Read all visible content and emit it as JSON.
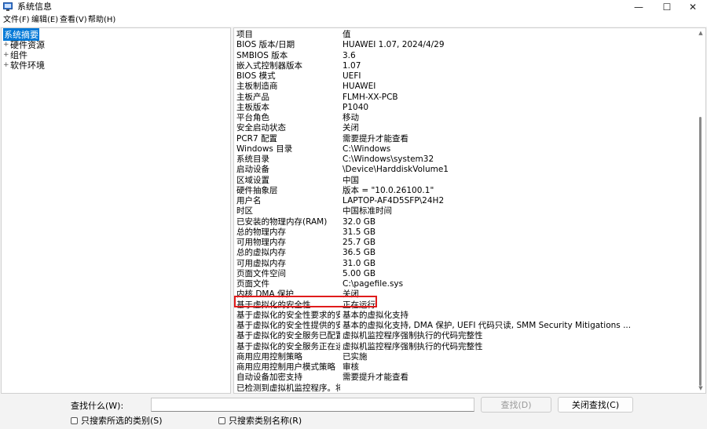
{
  "window": {
    "title": "系统信息",
    "controls": {
      "minimize": "—",
      "maximize": "☐",
      "close": "✕"
    }
  },
  "menu": [
    "文件(F)",
    "编辑(E)",
    "查看(V)",
    "帮助(H)"
  ],
  "tree": [
    {
      "label": "系统摘要",
      "expander": "",
      "selected": true
    },
    {
      "label": "硬件资源",
      "expander": "+",
      "selected": false
    },
    {
      "label": "组件",
      "expander": "+",
      "selected": false
    },
    {
      "label": "软件环境",
      "expander": "+",
      "selected": false
    }
  ],
  "table": {
    "rows": [
      [
        "项目",
        "值"
      ],
      [
        "BIOS 版本/日期",
        "HUAWEI 1.07, 2024/4/29"
      ],
      [
        "SMBIOS 版本",
        "3.6"
      ],
      [
        "嵌入式控制器版本",
        "1.07"
      ],
      [
        "BIOS 模式",
        "UEFI"
      ],
      [
        "主板制造商",
        "HUAWEI"
      ],
      [
        "主板产品",
        "FLMH-XX-PCB"
      ],
      [
        "主板版本",
        "P1040"
      ],
      [
        "平台角色",
        "移动"
      ],
      [
        "安全启动状态",
        "关闭"
      ],
      [
        "PCR7 配置",
        "需要提升才能查看"
      ],
      [
        "Windows 目录",
        "C:\\Windows"
      ],
      [
        "系统目录",
        "C:\\Windows\\system32"
      ],
      [
        "启动设备",
        "\\Device\\HarddiskVolume1"
      ],
      [
        "区域设置",
        "中国"
      ],
      [
        "硬件抽象层",
        "版本 = \"10.0.26100.1\""
      ],
      [
        "用户名",
        "LAPTOP-AF4D5SFP\\24H2"
      ],
      [
        "时区",
        "中国标准时间"
      ],
      [
        "已安装的物理内存(RAM)",
        "32.0 GB"
      ],
      [
        "总的物理内存",
        "31.5 GB"
      ],
      [
        "可用物理内存",
        "25.7 GB"
      ],
      [
        "总的虚拟内存",
        "36.5 GB"
      ],
      [
        "可用虚拟内存",
        "31.0 GB"
      ],
      [
        "页面文件空间",
        "5.00 GB"
      ],
      [
        "页面文件",
        "C:\\pagefile.sys"
      ],
      [
        "内核 DMA 保护",
        "关闭"
      ],
      [
        "基于虚拟化的安全性",
        "正在运行"
      ],
      [
        "基于虚拟化的安全性要求的安...",
        "基本的虚拟化支持"
      ],
      [
        "基于虚拟化的安全性提供的安...",
        "基本的虚拟化支持, DMA 保护, UEFI 代码只读, SMM Security Mitigations ..."
      ],
      [
        "基于虚拟化的安全服务已配置",
        "虚拟机监控程序强制执行的代码完整性"
      ],
      [
        "基于虚拟化的安全服务正在运行",
        "虚拟机监控程序强制执行的代码完整性"
      ],
      [
        "商用应用控制策略",
        "已实施"
      ],
      [
        "商用应用控制用户模式策略",
        "审核"
      ],
      [
        "自动设备加密支持",
        "需要提升才能查看"
      ],
      [
        "已检测到虚拟机监控程序。将...",
        ""
      ]
    ]
  },
  "find": {
    "label": "查找什么(W):",
    "value": "",
    "find_button": "查找(D)",
    "close_find_button": "关闭查找(C)",
    "search_selected_category": "只搜索所选的类别(S)",
    "search_category_names": "只搜索类别名称(R)"
  },
  "colors": {
    "selection": "#0078d7",
    "highlight_box": "#e01b1b"
  }
}
